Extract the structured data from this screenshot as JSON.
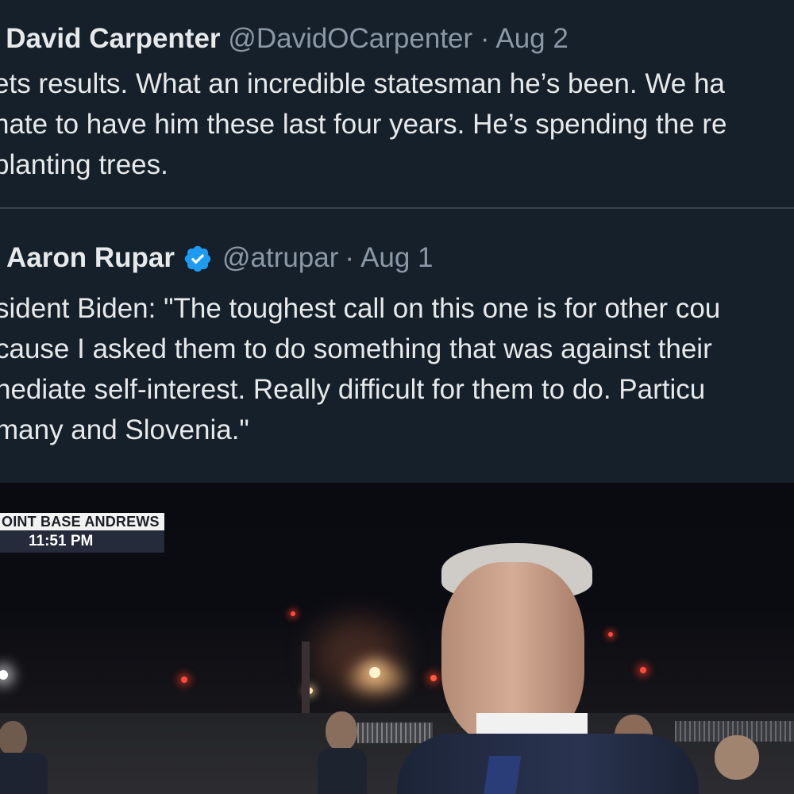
{
  "main_tweet": {
    "name": "e David Carpenter",
    "handle": "@DavidOCarpenter",
    "separator": "·",
    "date": "Aug 2",
    "lines": [
      "ets results. What an incredible statesman he’s been. We ha",
      "nate to have him these last four years. He’s spending the re",
      "planting trees."
    ]
  },
  "quoted_tweet": {
    "name": "Aaron Rupar",
    "verified_icon": "verified-badge-icon",
    "handle": "@atrupar",
    "separator": "·",
    "date": "Aug 1",
    "lines": [
      "sident Biden: \"The toughest call on this one is for other cou",
      "cause I asked them to do something that was against their",
      "nediate self-interest. Really difficult for them to do. Particu",
      "many and Slovenia.\""
    ]
  },
  "media": {
    "location": "OINT BASE ANDREWS",
    "time": "11:51 PM"
  },
  "colors": {
    "background": "#15202b",
    "text": "#e7e9ea",
    "secondary_text": "#8b98a5",
    "verified": "#1d9bf0"
  }
}
